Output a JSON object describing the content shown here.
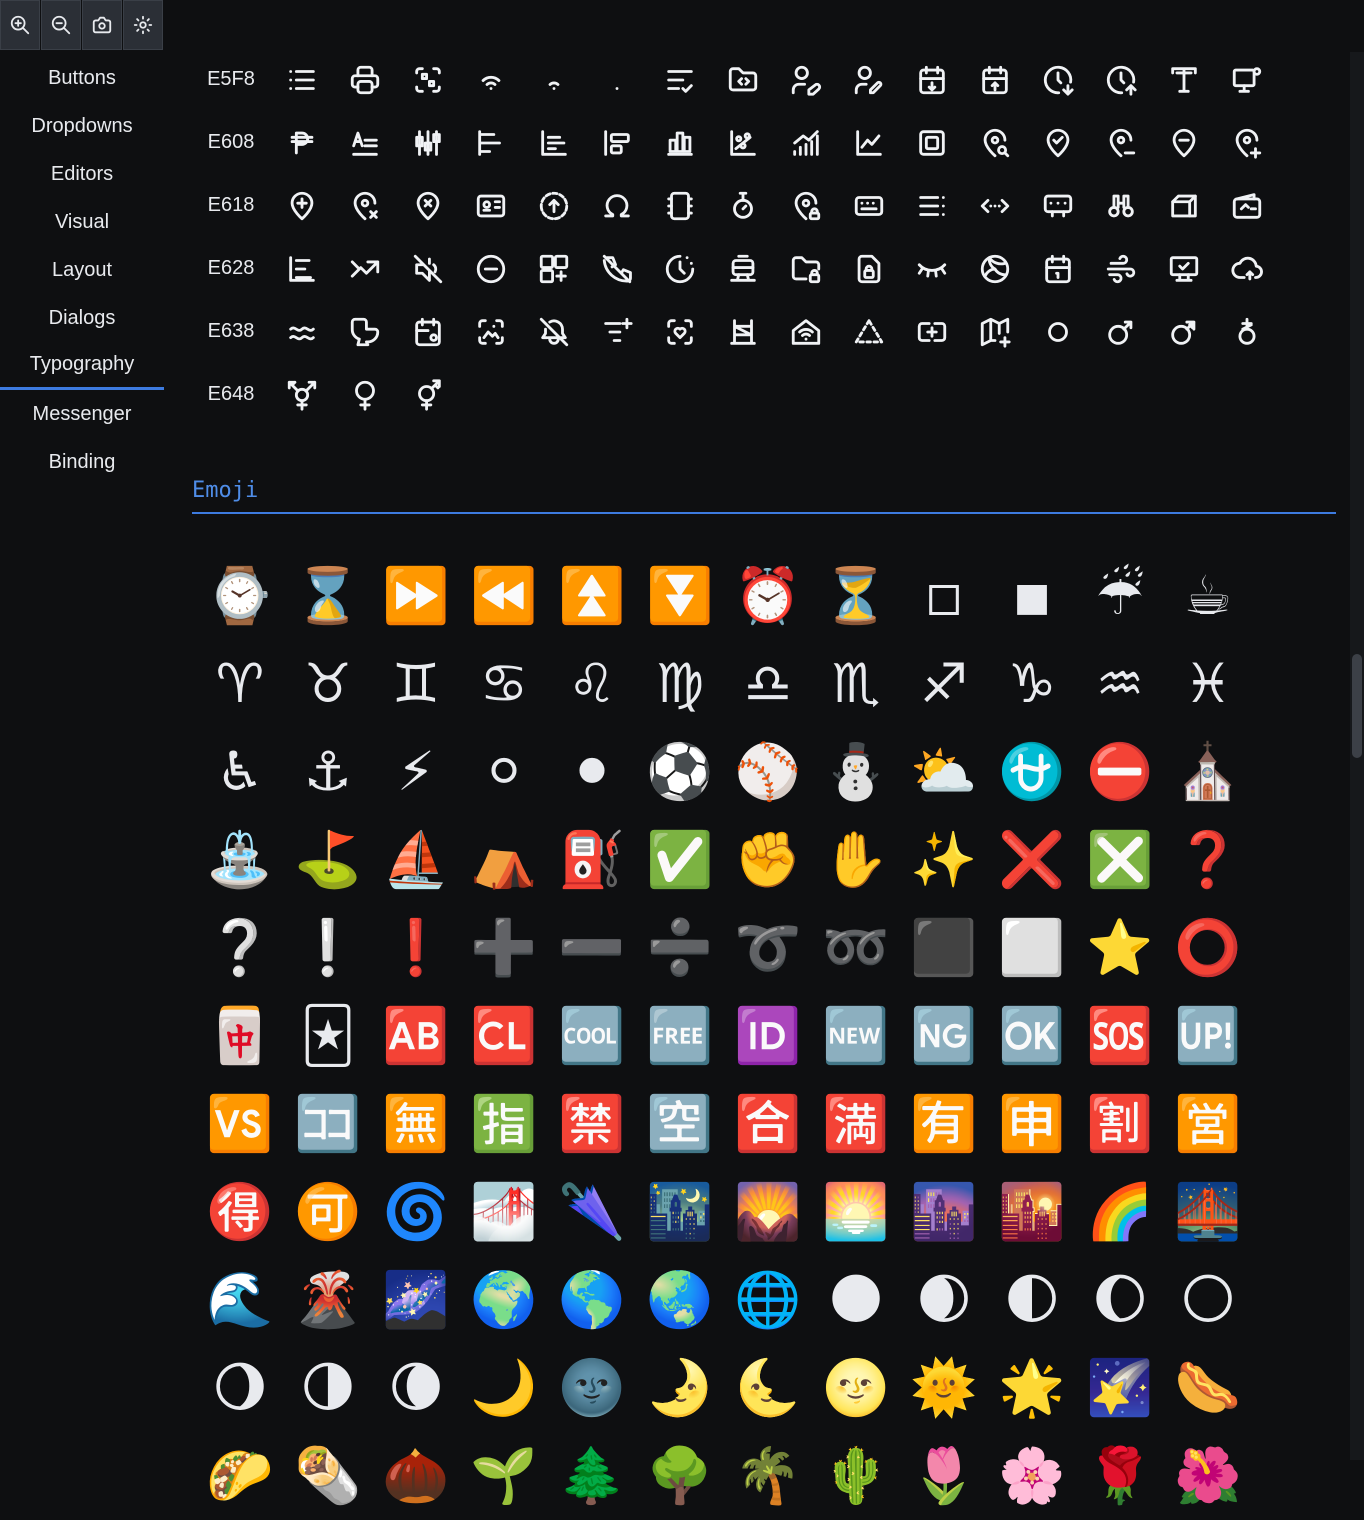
{
  "toolbar": {
    "buttons": [
      {
        "name": "zoom-in",
        "icon": "zoom-in-icon"
      },
      {
        "name": "zoom-out",
        "icon": "zoom-out-icon"
      },
      {
        "name": "screenshot",
        "icon": "camera-icon"
      },
      {
        "name": "theme-toggle",
        "icon": "sun-icon"
      }
    ]
  },
  "sidebar": {
    "items": [
      {
        "label": "Buttons",
        "active": false
      },
      {
        "label": "Dropdowns",
        "active": false
      },
      {
        "label": "Editors",
        "active": false
      },
      {
        "label": "Visual",
        "active": false
      },
      {
        "label": "Layout",
        "active": false
      },
      {
        "label": "Dialogs",
        "active": false
      },
      {
        "label": "Typography",
        "active": true
      },
      {
        "label": "Messenger",
        "active": false
      },
      {
        "label": "Binding",
        "active": false
      }
    ],
    "active_color": "#3d7be0"
  },
  "glyph_table": {
    "rows": [
      {
        "code": "E5F8",
        "icons": [
          "list-bullets-icon",
          "printer-icon",
          "scan-icon",
          "wifi-icon",
          "wifi-low-icon",
          "dot-icon",
          "list-check-icon",
          "folder-code-icon",
          "user-edit-icon",
          "user-pen-icon",
          "calendar-down-icon",
          "calendar-up-icon",
          "clock-down-icon",
          "clock-up-icon",
          "typography-icon",
          "monitor-settings-icon"
        ]
      },
      {
        "code": "E608",
        "icons": [
          "peso-icon",
          "text-align-icon",
          "chart-candle-icon",
          "chart-bar-left-icon",
          "chart-bar-left-2-icon",
          "layout-align-left-icon",
          "chart-bar-icon",
          "chart-scatter-icon",
          "chart-growth-icon",
          "chart-line-icon",
          "square-frame-icon",
          "map-pin-search-icon",
          "map-pin-check-icon",
          "map-pin-minus-search-icon",
          "map-pin-minus-icon",
          "map-pin-plus-search-icon"
        ]
      },
      {
        "code": "E618",
        "icons": [
          "map-pin-plus-icon",
          "map-pin-x-search-icon",
          "map-pin-x-icon",
          "id-card-icon",
          "circle-arrow-up-icon",
          "omega-icon",
          "rectangle-vertical-icon",
          "stopwatch-icon",
          "map-pin-lock-icon",
          "keyboard-icon",
          "list-dots-icon",
          "arrows-horizontal-icon",
          "device-icon",
          "binoculars-icon",
          "box-icon",
          "wallet-icon"
        ]
      },
      {
        "code": "E628",
        "icons": [
          "chart-bar-left-3-icon",
          "trending-icon",
          "volume-off-icon",
          "circle-minus-icon",
          "layout-plus-icon",
          "phone-off-icon",
          "clock-half-icon",
          "train-icon",
          "folder-lock-icon",
          "file-lock-icon",
          "eye-closed-icon",
          "volleyball-icon",
          "calendar-one-icon",
          "wind-icon",
          "monitor-check-icon",
          "cloud-icon"
        ]
      },
      {
        "code": "E638",
        "icons": [
          "approx-icon",
          "toilet-icon",
          "calendar-settings-icon",
          "image-scan-icon",
          "bell-off-icon",
          "filter-plus-icon",
          "heart-scan-icon",
          "scaffold-icon",
          "home-wifi-icon",
          "triangle-dashed-icon",
          "input-plus-icon",
          "map-plus-icon",
          "circle-icon",
          "mars-icon",
          "mars-2-icon",
          "gender-agender-icon"
        ]
      },
      {
        "code": "E648",
        "icons": [
          "transgender-icon",
          "venus-icon",
          "genderfluid-icon"
        ]
      }
    ]
  },
  "emoji_section": {
    "title": "Emoji",
    "title_color": "#4f8de8",
    "rows": [
      [
        "⌚",
        "⌛",
        "⏩",
        "⏪",
        "⏫",
        "⏬",
        "⏰",
        "⏳",
        "◽",
        "◾",
        "☔",
        "☕"
      ],
      [
        "♈",
        "♉",
        "♊",
        "♋",
        "♌",
        "♍",
        "♎",
        "♏",
        "♐",
        "♑",
        "♒",
        "♓"
      ],
      [
        "♿",
        "⚓",
        "⚡",
        "⚪",
        "⚫",
        "⚽",
        "⚾",
        "⛄",
        "⛅",
        "⛎",
        "⛔",
        "⛪"
      ],
      [
        "⛲",
        "⛳",
        "⛵",
        "⛺",
        "⛽",
        "✅",
        "✊",
        "✋",
        "✨",
        "❌",
        "❎",
        "❓"
      ],
      [
        "❔",
        "❕",
        "❗",
        "➕",
        "➖",
        "➗",
        "➰",
        "➿",
        "⬛",
        "⬜",
        "⭐",
        "⭕"
      ],
      [
        "🀄",
        "🃏",
        "🆎",
        "🆑",
        "🆒",
        "🆓",
        "🆔",
        "🆕",
        "🆖",
        "🆗",
        "🆘",
        "🆙"
      ],
      [
        "🆚",
        "🈁",
        "🈚",
        "🈯",
        "🈲",
        "🈳",
        "🈴",
        "🈵",
        "🈶",
        "🈸",
        "🈹",
        "🈺"
      ],
      [
        "🉐",
        "🉑",
        "🌀",
        "🌁",
        "🌂",
        "🌃",
        "🌄",
        "🌅",
        "🌆",
        "🌇",
        "🌈",
        "🌉"
      ],
      [
        "🌊",
        "🌋",
        "🌌",
        "🌍",
        "🌎",
        "🌏",
        "🌐",
        "🌑",
        "🌒",
        "🌓",
        "🌔",
        "🌕"
      ],
      [
        "🌖",
        "🌗",
        "🌘",
        "🌙",
        "🌚",
        "🌛",
        "🌜",
        "🌝",
        "🌞",
        "🌟",
        "🌠",
        "🌭"
      ],
      [
        "🌮",
        "🌯",
        "🌰",
        "🌱",
        "🌲",
        "🌳",
        "🌴",
        "🌵",
        "🌷",
        "🌸",
        "🌹",
        "🌺"
      ]
    ]
  }
}
